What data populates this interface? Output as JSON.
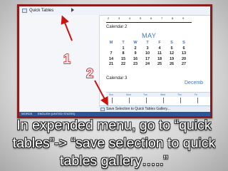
{
  "screenshot": {
    "menu_item_quick_tables": "Quick Tables",
    "days_row": [
      "2",
      "3",
      "4",
      "5",
      "6",
      "7",
      "8",
      "9"
    ],
    "calendar2_label": "Calendar 2",
    "month": "MAY",
    "weekday_headers": [
      "M",
      "T",
      "W",
      "T",
      "F",
      "S",
      "S"
    ],
    "calendar_rows": [
      [
        "",
        "1",
        "2",
        "3",
        "4",
        "5",
        "6"
      ],
      [
        "7",
        "8",
        "9",
        "10",
        "11",
        "12",
        "13"
      ],
      [
        "14",
        "15",
        "16",
        "17",
        "18",
        "19",
        "20"
      ],
      [
        "21",
        "22",
        "23",
        "24",
        "25",
        "26",
        "27"
      ]
    ],
    "calendar3_label": "Calendar 3",
    "december_fragment": "Decemb",
    "week_labels": [
      "Sun",
      "Mon",
      "Tue",
      "Wed",
      "Thu",
      "Fri"
    ],
    "save_selection_label": "Save Selection to Quick Tables Gallery...",
    "status_words": "WORDS",
    "status_language": "ENGLISH (UNITED STATES)"
  },
  "markers": {
    "one": "1",
    "two": "2"
  },
  "caption": {
    "line1": "In expended menu, go to “quick",
    "line2": "tables”-> “save selection to quick",
    "line3": "tables gallery…..”"
  },
  "colors": {
    "frame": "#8c1d1d",
    "arrow": "#cc1111",
    "accent_blue": "#3a77c0",
    "status_bar": "#2b579a"
  }
}
